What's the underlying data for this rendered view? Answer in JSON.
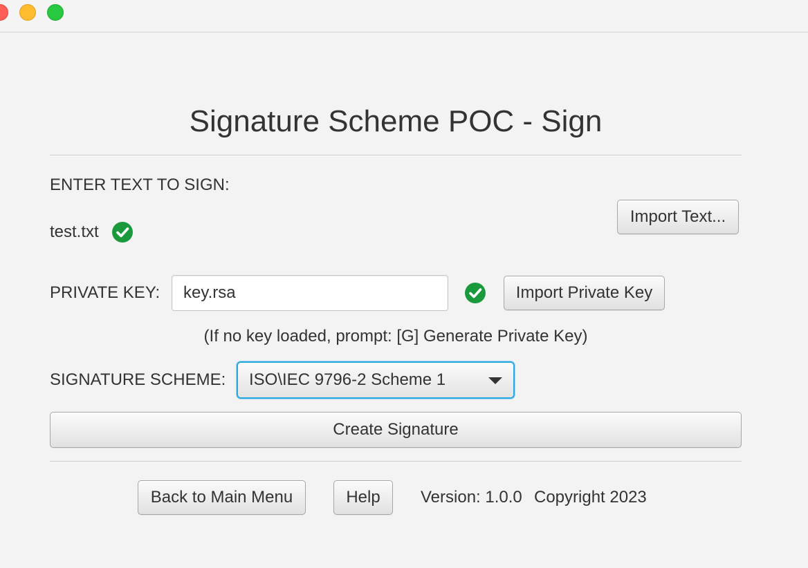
{
  "window": {
    "controls": {
      "close": "close-button",
      "minimize": "minimize-button",
      "zoom": "zoom-button"
    }
  },
  "page": {
    "title": "Signature Scheme POC - Sign"
  },
  "text_section": {
    "label": "ENTER TEXT TO SIGN:",
    "file_name": "test.txt",
    "status_icon": "check-circle-icon",
    "import_button": "Import Text..."
  },
  "key_section": {
    "label": "PRIVATE KEY:",
    "field_value": "key.rsa",
    "status_icon": "check-circle-icon",
    "import_button": "Import Private Key",
    "hint": "(If no key loaded, prompt: [G] Generate Private Key)"
  },
  "scheme_section": {
    "label": "SIGNATURE SCHEME:",
    "selected": "ISO\\IEC 9796-2 Scheme 1"
  },
  "actions": {
    "create_signature": "Create Signature"
  },
  "footer": {
    "back_button": "Back to Main Menu",
    "help_button": "Help",
    "version": "Version: 1.0.0",
    "copyright": "Copyright 2023"
  },
  "colors": {
    "background": "#f3f3f3",
    "success_green": "#1a9a3c",
    "focus_blue": "#29a8e0",
    "text": "#333333"
  }
}
